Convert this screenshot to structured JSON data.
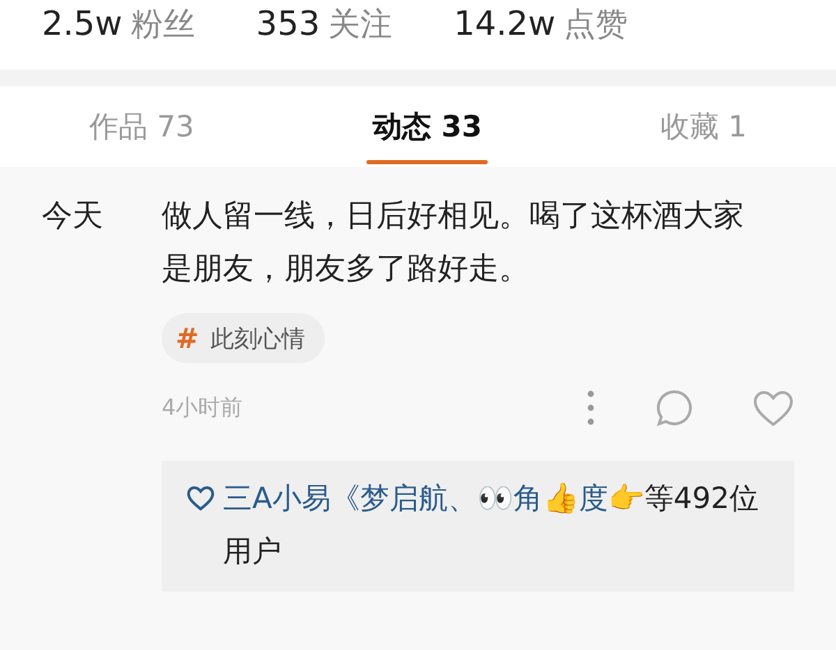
{
  "stats": [
    {
      "value": "2.5w",
      "label": "粉丝"
    },
    {
      "value": "353",
      "label": "关注"
    },
    {
      "value": "14.2w",
      "label": "点赞"
    }
  ],
  "tabs": [
    {
      "label": "作品 73",
      "selected": false
    },
    {
      "label": "动态 33",
      "selected": true
    },
    {
      "label": "收藏 1",
      "selected": false
    }
  ],
  "post": {
    "date": "今天",
    "text": "做人留一线，日后好相见。喝了这杯酒大家是朋友，朋友多了路好走。",
    "tag": {
      "symbol": "#",
      "label": "此刻心情"
    },
    "time": "4小时前",
    "likes": {
      "users": "三A小易《梦启航、👀角👍度👉",
      "suffix": "等492位用户"
    }
  }
}
